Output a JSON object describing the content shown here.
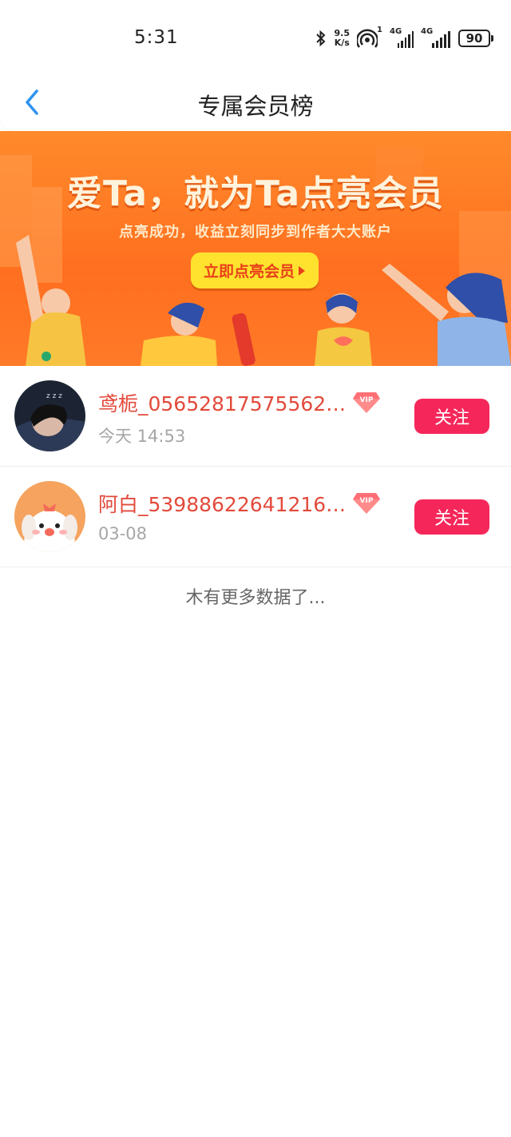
{
  "status_bar": {
    "time": "5:31",
    "net_speed_value": "9.5",
    "net_speed_unit": "K/s",
    "hotspot_count": "1",
    "sim1_label": "4G",
    "sim2_label": "4G",
    "battery": "90"
  },
  "nav": {
    "title": "专属会员榜"
  },
  "banner": {
    "headline": "爱Ta，就为Ta点亮会员",
    "subtitle": "点亮成功，收益立刻同步到作者大大账户",
    "cta_label": "立即点亮会员"
  },
  "members": [
    {
      "name": "鸢栀_05652817575562…",
      "time": "今天  14:53",
      "follow_label": "关注",
      "vip": "VIP"
    },
    {
      "name": "阿白_53988622641216…",
      "time": "03-08",
      "follow_label": "关注",
      "vip": "VIP"
    }
  ],
  "footer": {
    "no_more": "木有更多数据了..."
  },
  "colors": {
    "accent_blue": "#2e93f0",
    "follow_pink": "#f5275a",
    "name_red": "#e24a3b",
    "banner_orange": "#ff7a28"
  }
}
